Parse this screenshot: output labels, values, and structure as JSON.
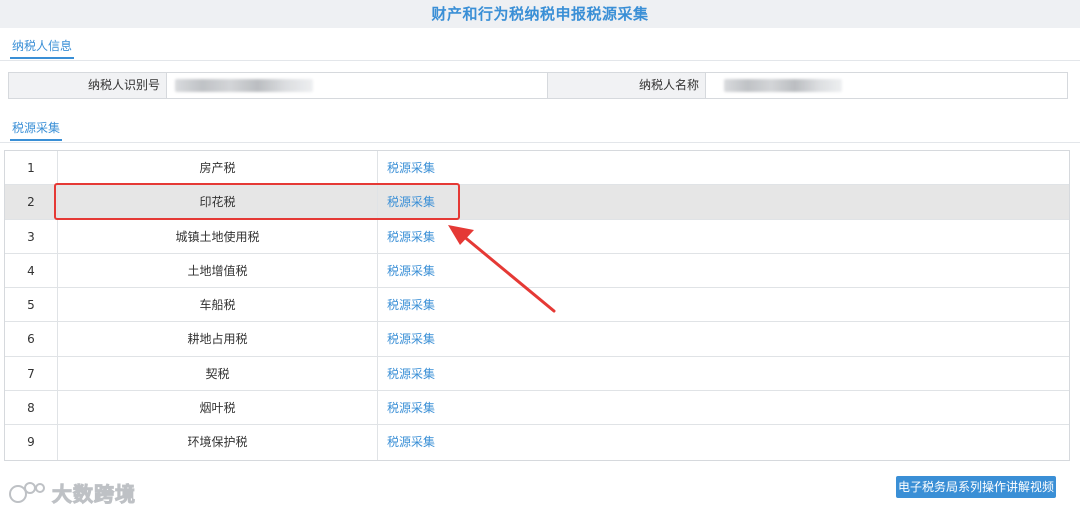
{
  "header": {
    "title": "财产和行为税纳税申报税源采集"
  },
  "taxpayer_section": {
    "tab_label": "纳税人信息"
  },
  "taxpayer": {
    "id_label": "纳税人识别号",
    "name_label": "纳税人名称"
  },
  "source_section": {
    "tab_label": "税源采集"
  },
  "rows": [
    {
      "num": "1",
      "name": "房产税",
      "action": "税源采集"
    },
    {
      "num": "2",
      "name": "印花税",
      "action": "税源采集"
    },
    {
      "num": "3",
      "name": "城镇土地使用税",
      "action": "税源采集"
    },
    {
      "num": "4",
      "name": "土地增值税",
      "action": "税源采集"
    },
    {
      "num": "5",
      "name": "车船税",
      "action": "税源采集"
    },
    {
      "num": "6",
      "name": "耕地占用税",
      "action": "税源采集"
    },
    {
      "num": "7",
      "name": "契税",
      "action": "税源采集"
    },
    {
      "num": "8",
      "name": "烟叶税",
      "action": "税源采集"
    },
    {
      "num": "9",
      "name": "环境保护税",
      "action": "税源采集"
    }
  ],
  "footer": {
    "watermark_text": "大数跨境",
    "help_button_label": "电子税务局系列操作讲解视频"
  },
  "colors": {
    "accent": "#3a8fd6",
    "highlight": "#e53935",
    "selected_row": "#e6e6e6"
  }
}
